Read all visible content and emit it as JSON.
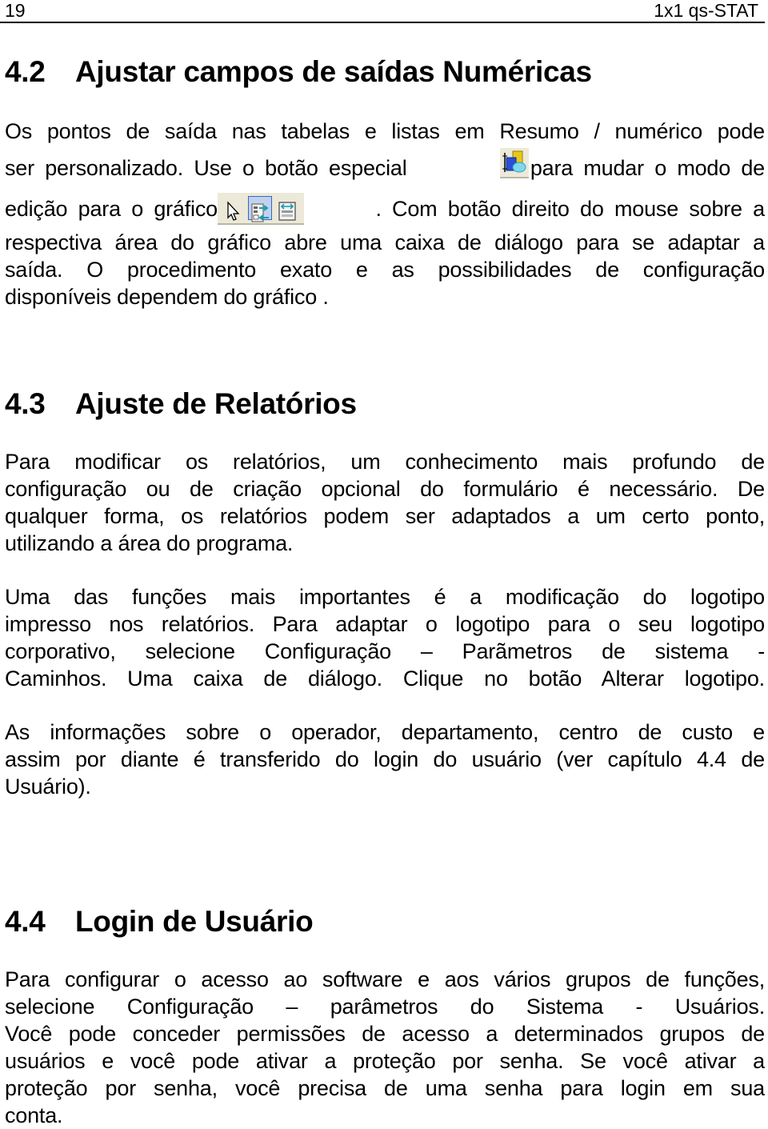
{
  "header": {
    "page_number": "19",
    "doc_title": "1x1 qs-STAT"
  },
  "sections": [
    {
      "number": "4.2",
      "title": "Ajustar campos de saídas Numéricas",
      "paragraphs": [
        {
          "lines": [
            "Os pontos de saída nas tabelas e listas em Resumo / numérico  pode",
            "ser personalizado. Use o botão especial",
            "para mudar o modo de",
            "edição para o gráfico",
            ". Com botão direito do mouse sobre a",
            "respectiva área do gráfico abre uma caixa de diálogo para se adaptar a",
            "saída. O procedimento exato e as possibilidades de configuração",
            "disponíveis dependem do gráfico ."
          ],
          "icons": {
            "special_button": "chart-edit-mode-icon",
            "toolbar": [
              "pointer-arrow-icon",
              "move-fields-icon",
              "resize-columns-icon"
            ]
          }
        }
      ]
    },
    {
      "number": "4.3",
      "title": "Ajuste de Relatórios",
      "paragraphs": [
        {
          "lines": [
            "Para modificar os relatórios, um conhecimento mais profundo de",
            "configuração ou de criação opcional do formulário é necessário. De",
            "qualquer forma, os relatórios podem ser adaptados a um certo ponto,",
            "utilizando a área do programa."
          ]
        },
        {
          "lines": [
            "Uma das funções mais importantes é a modificação do logotipo",
            "impresso nos relatórios. Para adaptar o logotipo para o seu logotipo",
            "corporativo, selecione Configuração – Parãmetros de sistema -",
            "Caminhos. Uma caixa de diálogo. Clique no botão Alterar logotipo."
          ]
        },
        {
          "lines": [
            "As informações sobre o operador, departamento, centro de custo e",
            "assim por diante é transferido do login do usuário (ver capítulo 4.4 de",
            "Usuário)."
          ]
        }
      ]
    },
    {
      "number": "4.4",
      "title": "Login de Usuário",
      "paragraphs": [
        {
          "lines": [
            "Para configurar o acesso ao software e aos vários grupos de funções,",
            "selecione Configuração – parâmetros do Sistema - Usuários.",
            "Você pode conceder permissões de acesso a determinados grupos de",
            "usuários e você pode ativar a proteção por senha. Se você ativar a",
            "proteção por senha, você precisa de uma senha para login em sua",
            "conta."
          ]
        }
      ]
    }
  ]
}
